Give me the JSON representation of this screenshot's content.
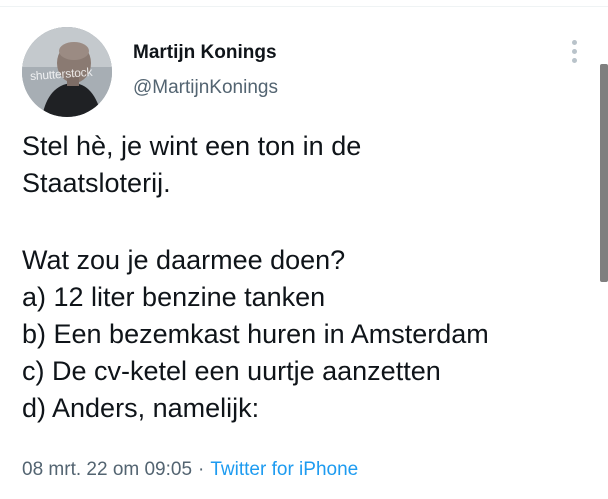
{
  "author": {
    "name": "Martijn Konings",
    "handle": "@MartijnKonings",
    "avatar_watermark": "shutterstock"
  },
  "tweet": {
    "lines": [
      "Stel hè, je wint een ton in de",
      "Staatsloterij."
    ],
    "question": "Wat zou je daarmee doen?",
    "options": [
      "a) 12 liter benzine tanken",
      "b) Een bezemkast huren in Amsterdam",
      "c) De cv-ketel een uurtje aanzetten",
      "d) Anders, namelijk:"
    ]
  },
  "meta": {
    "timestamp": "08 mrt. 22 om 09:05",
    "separator": "·",
    "source": "Twitter for iPhone"
  },
  "icons": {
    "more": "more-vertical-icon"
  },
  "colors": {
    "text": "#0f1419",
    "secondary": "#536471",
    "link": "#1d9bf0"
  }
}
